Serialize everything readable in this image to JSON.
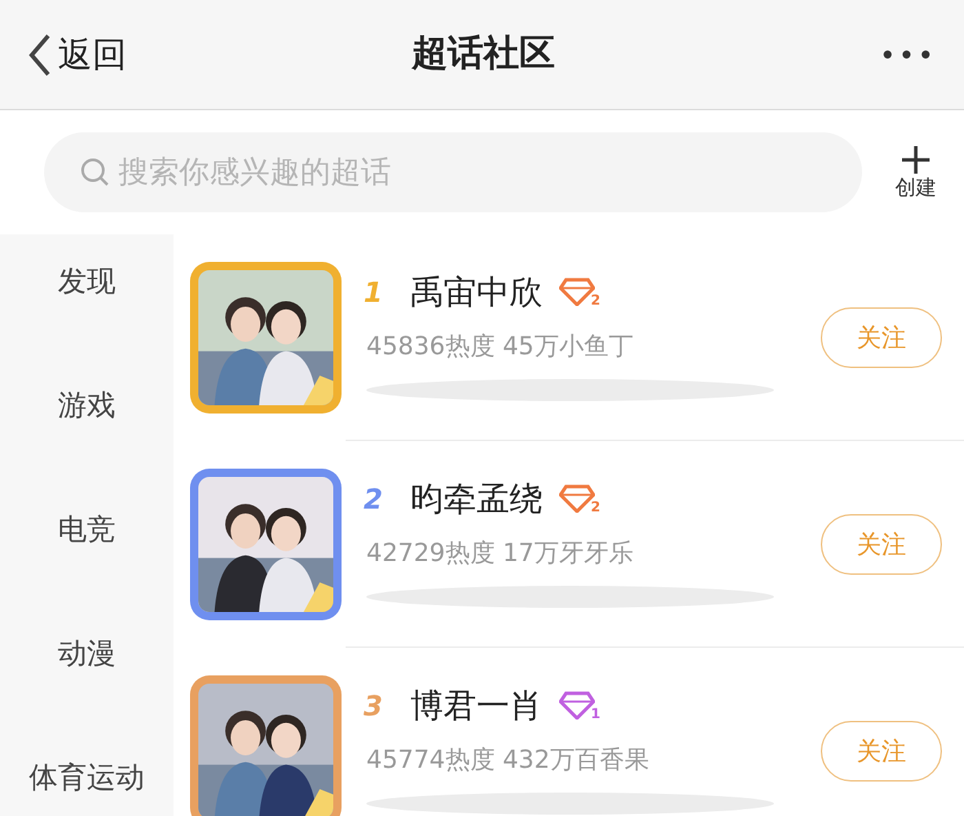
{
  "header": {
    "back_label": "返回",
    "title": "超话社区",
    "more": "•••"
  },
  "search": {
    "placeholder": "搜索你感兴趣的超话",
    "create_label": "创建"
  },
  "sidebar": {
    "items": [
      {
        "label": "发现"
      },
      {
        "label": "游戏"
      },
      {
        "label": "电竞"
      },
      {
        "label": "动漫"
      },
      {
        "label": "体育运动"
      }
    ]
  },
  "topics": [
    {
      "rank": "1",
      "color": "#f0b030",
      "name": "禹宙中欣",
      "badge": {
        "level": "2",
        "color": "#f07a40"
      },
      "stats": "45836热度 45万小鱼丁",
      "follow_label": "关注"
    },
    {
      "rank": "2",
      "color": "#6f8fef",
      "name": "昀牵孟绕",
      "badge": {
        "level": "2",
        "color": "#f07a40"
      },
      "stats": "42729热度 17万牙牙乐",
      "follow_label": "关注"
    },
    {
      "rank": "3",
      "color": "#e8a060",
      "name": "博君一肖",
      "badge": {
        "level": "1",
        "color": "#c060e0"
      },
      "stats": "45774热度 432万百香果",
      "follow_label": "关注"
    }
  ]
}
